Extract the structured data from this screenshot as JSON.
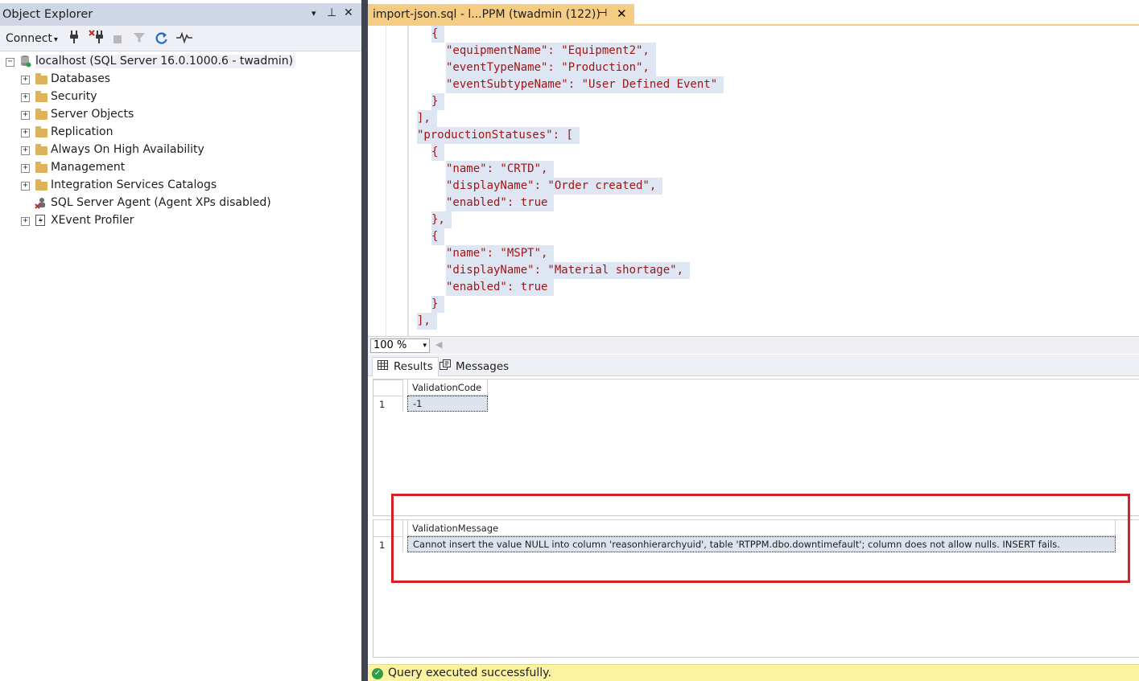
{
  "object_explorer": {
    "title": "Object Explorer",
    "title_controls": {
      "dropdown": "▾",
      "pin": "⊥",
      "close": "✕"
    },
    "toolbar": {
      "connect_label": "Connect",
      "connect_caret": "▾"
    },
    "server_node": "localhost (SQL Server 16.0.1000.6 - twadmin)",
    "nodes": [
      {
        "label": "Databases",
        "icon": "folder-icon"
      },
      {
        "label": "Security",
        "icon": "folder-icon"
      },
      {
        "label": "Server Objects",
        "icon": "folder-icon"
      },
      {
        "label": "Replication",
        "icon": "folder-icon"
      },
      {
        "label": "Always On High Availability",
        "icon": "folder-icon"
      },
      {
        "label": "Management",
        "icon": "folder-icon"
      },
      {
        "label": "Integration Services Catalogs",
        "icon": "folder-icon"
      },
      {
        "label": "SQL Server Agent (Agent XPs disabled)",
        "icon": "sql-agent-icon"
      },
      {
        "label": "XEvent Profiler",
        "icon": "xevent-icon"
      }
    ]
  },
  "document_tab": {
    "title": "import-json.sql - l...PPM (twadmin (122))",
    "pin": "⊣",
    "close": "✕"
  },
  "editor": {
    "lines": [
      "{",
      "\"equipmentName\": \"Equipment2\",",
      "\"eventTypeName\": \"Production\",",
      "\"eventSubtypeName\": \"User Defined Event\"",
      "}",
      "],",
      "\"productionStatuses\": [",
      "{",
      "\"name\": \"CRTD\",",
      "\"displayName\": \"Order created\",",
      "\"enabled\": true",
      "},",
      "{",
      "\"name\": \"MSPT\",",
      "\"displayName\": \"Material shortage\",",
      "\"enabled\": true",
      "}",
      "],"
    ]
  },
  "zoom": {
    "value": "100 %",
    "caret": "▾"
  },
  "result_tabs": [
    {
      "label": "Results",
      "icon": "grid-icon"
    },
    {
      "label": "Messages",
      "icon": "messages-icon"
    }
  ],
  "results": {
    "grid1": {
      "column": "ValidationCode",
      "row_number": "1",
      "value": "-1"
    },
    "grid2": {
      "column": "ValidationMessage",
      "row_number": "1",
      "value": "Cannot insert the value NULL into column 'reasonhierarchyuid', table 'RTPPM.dbo.downtimefault'; column does not allow nulls. INSERT fails."
    }
  },
  "status": {
    "text": "Query executed successfully.",
    "icon": "success-check-icon",
    "check": "✓"
  },
  "colors": {
    "accent_tab": "#f5cc84",
    "highlight_box": "#d62028",
    "status_bar": "#fcf2a0",
    "json_string": "#a31515"
  }
}
